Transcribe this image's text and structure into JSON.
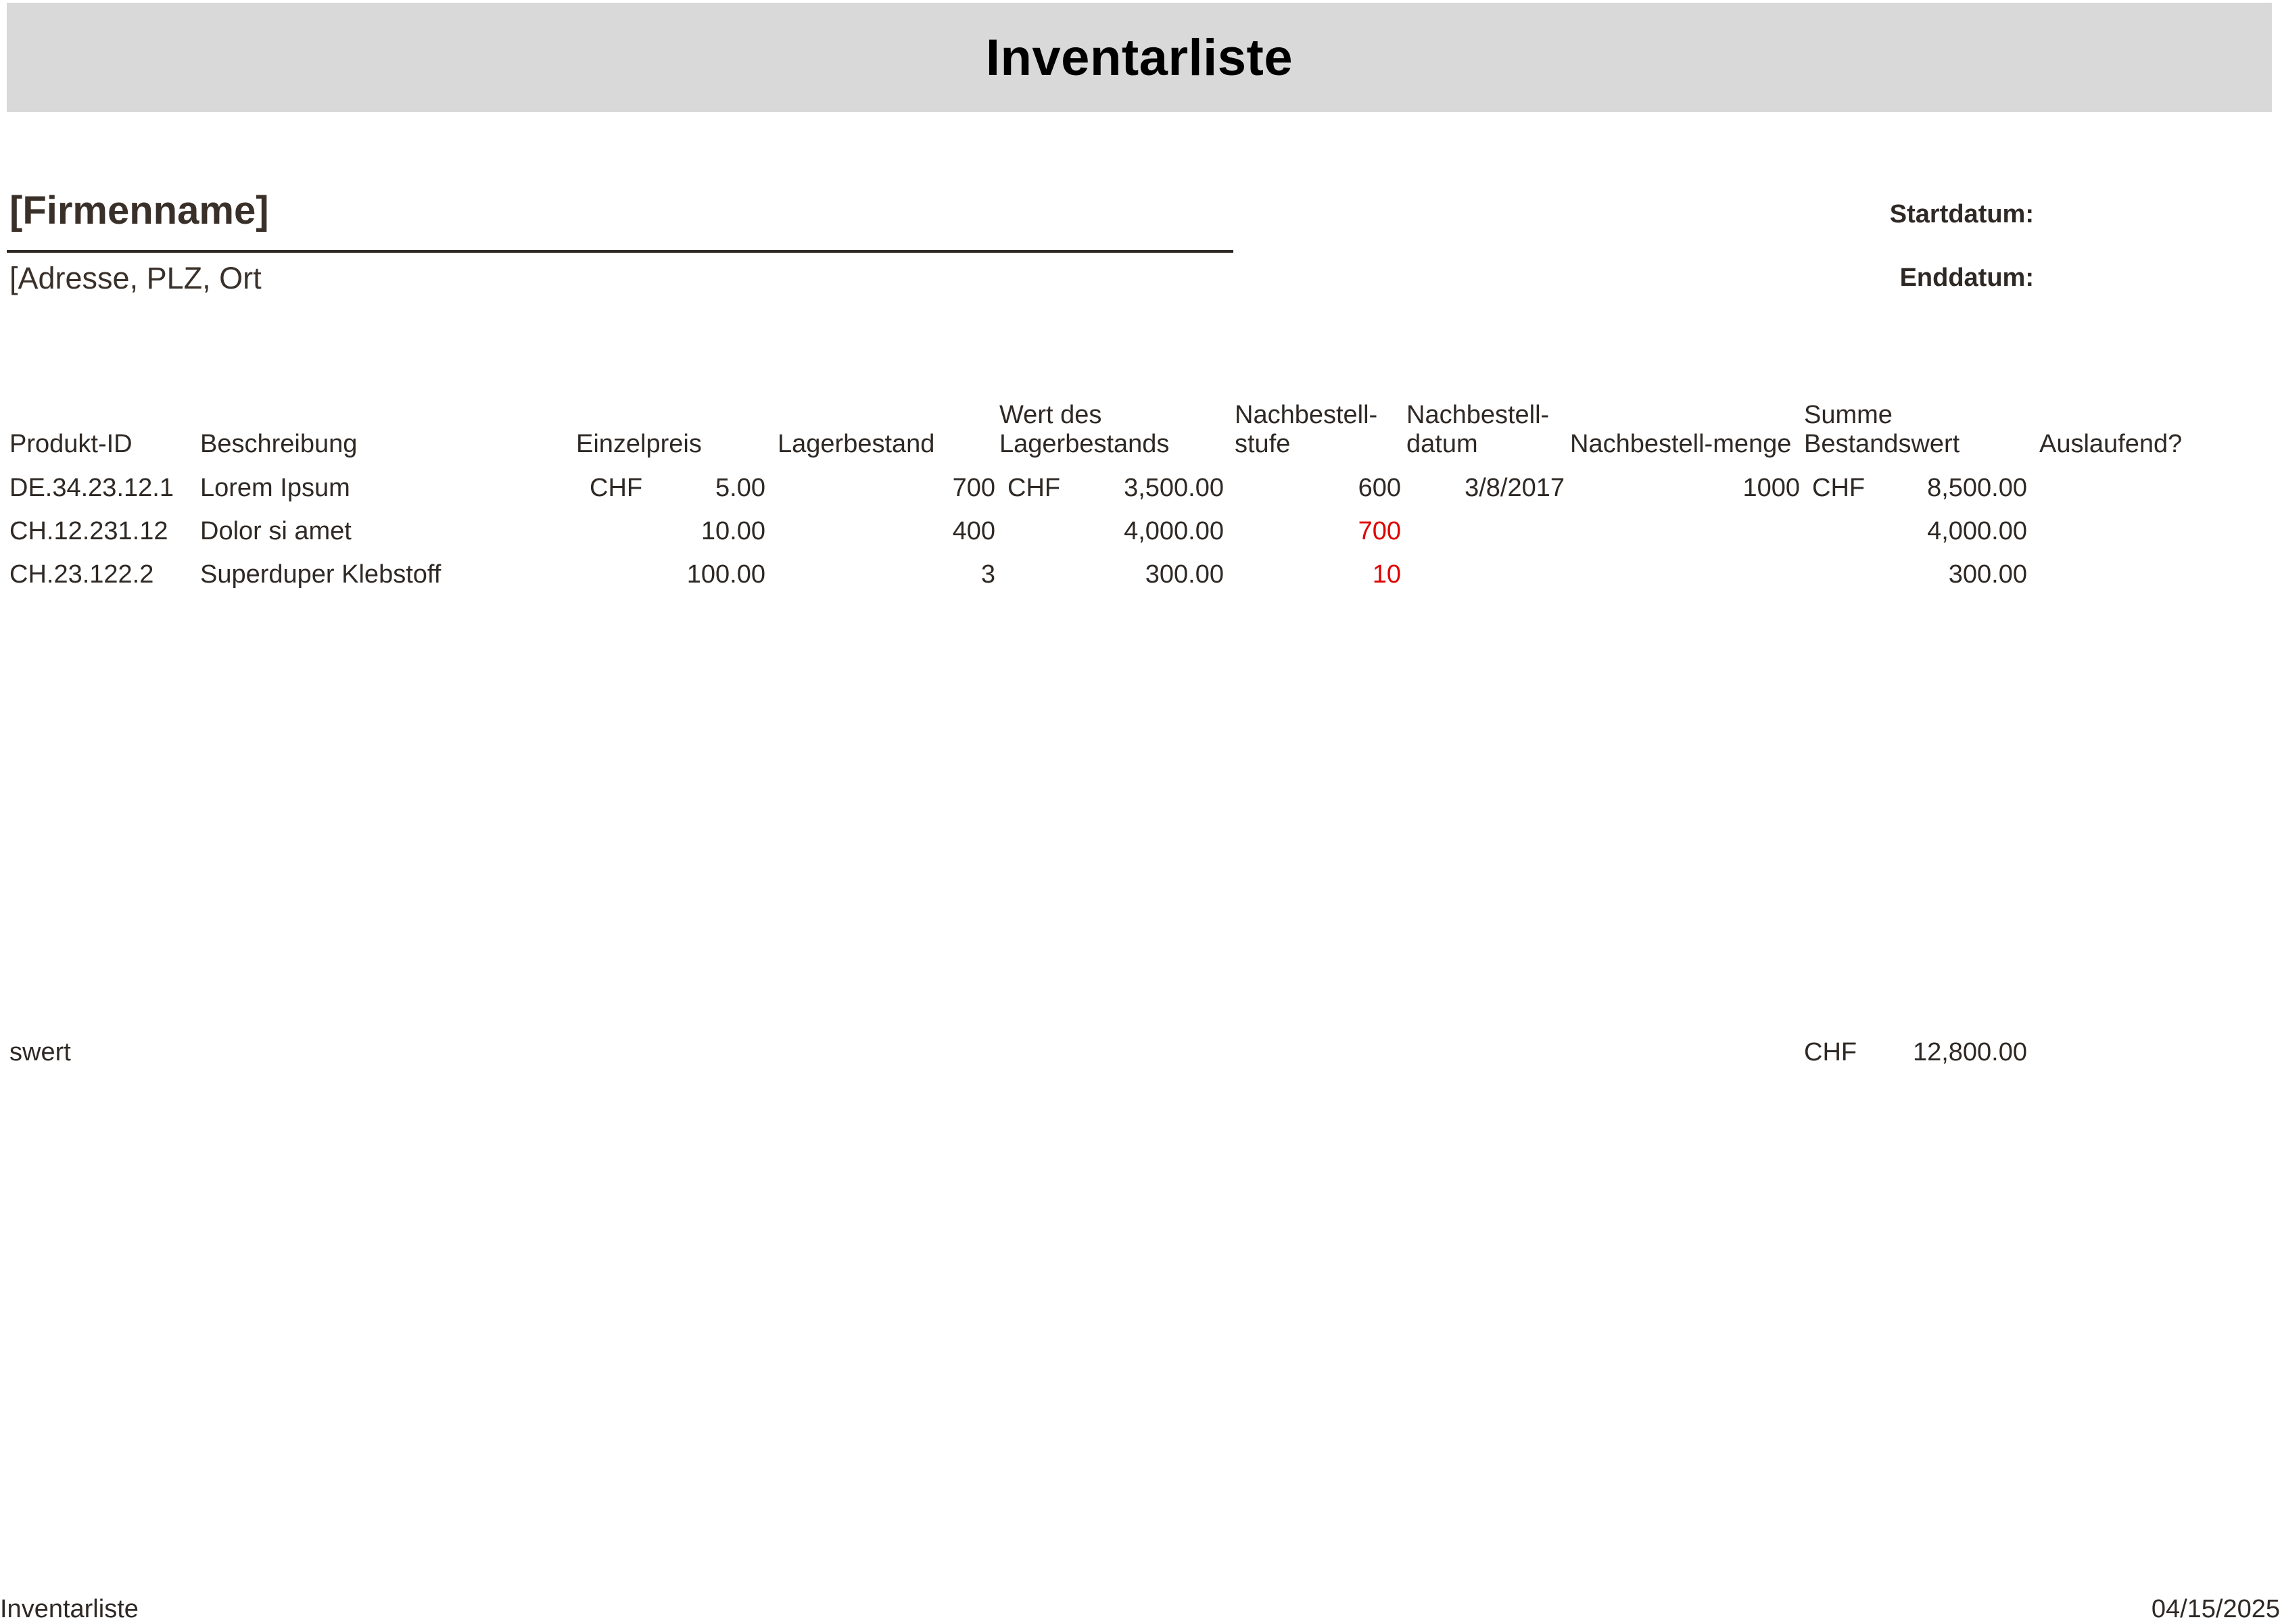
{
  "header": {
    "title": "Inventarliste"
  },
  "company": {
    "name": "[Firmenname]",
    "address": "[Adresse, PLZ, Ort",
    "start_label": "Startdatum:",
    "end_label": "Enddatum:"
  },
  "table": {
    "columns": [
      "Produkt-ID",
      "Beschreibung",
      "Einzelpreis",
      "Lagerbestand",
      "Wert des\nLagerbestands",
      "Nachbestell-\nstufe",
      "Nachbestell-\ndatum",
      "Nachbestell-menge",
      "Summe\nBestandswert",
      "Auslaufend?"
    ],
    "rows": [
      {
        "id": "DE.34.23.12.1",
        "desc": "Lorem Ipsum",
        "price_cur": "CHF",
        "price": "5.00",
        "stock": "700",
        "stock_value_cur": "CHF",
        "stock_value": "3,500.00",
        "reorder_level": "600",
        "reorder_date": "3/8/2017",
        "reorder_qty": "1000",
        "total_cur": "CHF",
        "total": "8,500.00"
      },
      {
        "id": "CH.12.231.12",
        "desc": "Dolor si amet",
        "price_cur": "",
        "price": "10.00",
        "stock": "400",
        "stock_value_cur": "",
        "stock_value": "4,000.00",
        "reorder_level": "700",
        "reorder_date": "",
        "reorder_qty": "",
        "total_cur": "",
        "total": "4,000.00"
      },
      {
        "id": "CH.23.122.2",
        "desc": "Superduper Klebstoff",
        "price_cur": "",
        "price": "100.00",
        "stock": "3",
        "stock_value_cur": "",
        "stock_value": "300.00",
        "reorder_level": "10",
        "reorder_date": "",
        "reorder_qty": "",
        "total_cur": "",
        "total": "300.00"
      }
    ],
    "flagged_color": "#e00000"
  },
  "summary": {
    "label": "swert",
    "currency": "CHF",
    "value": "12,800.00"
  },
  "footer": {
    "left": "Inventarliste",
    "right": "04/15/2025"
  }
}
